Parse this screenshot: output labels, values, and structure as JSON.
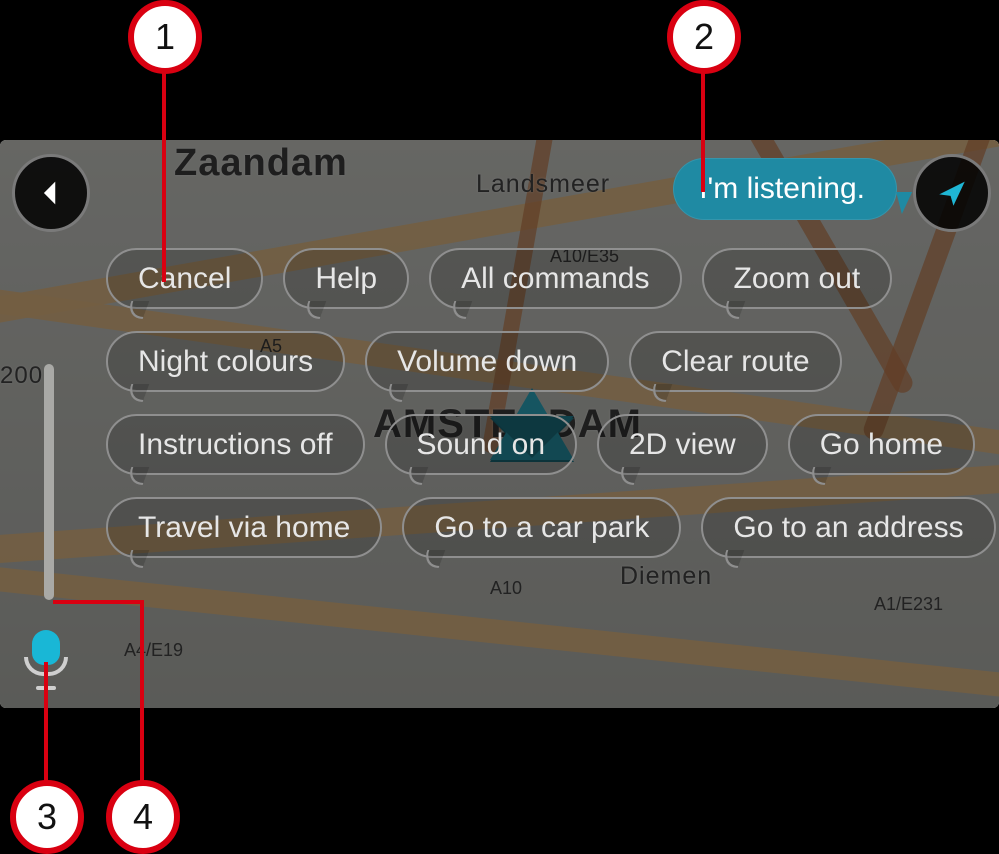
{
  "callouts": {
    "n1": "1",
    "n2": "2",
    "n3": "3",
    "n4": "4"
  },
  "listening_text": "I'm listening.",
  "map": {
    "city_primary": "AMSTERDAM",
    "zaandam": "Zaandam",
    "landsmeer": "Landsmeer",
    "diemen": "Diemen",
    "scale": "200",
    "roads": {
      "a10a": "A10/E35",
      "a5": "A5",
      "a10b": "A10",
      "a4": "A4/E19",
      "a1": "A1/E231"
    }
  },
  "commands": {
    "row1": [
      "Cancel",
      "Help",
      "All commands",
      "Zoom out"
    ],
    "row2": [
      "Night colours",
      "Volume down",
      "Clear route"
    ],
    "row3": [
      "Instructions off",
      "Sound on",
      "2D view",
      "Go home"
    ],
    "row4": [
      "Travel via home",
      "Go to a car park",
      "Go to an address"
    ]
  }
}
